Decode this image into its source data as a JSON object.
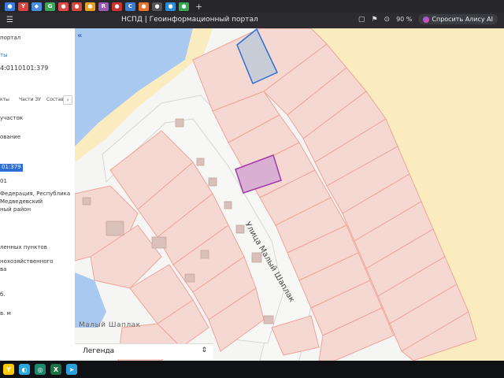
{
  "browser": {
    "page_title": "НСПД | Геоинформационный портал",
    "zoom": "90 %",
    "alice_label": "Спросить Алису AI",
    "tab_favicons": [
      {
        "name": "tab-favicon-1",
        "color": "#3b7ddd",
        "glyph": "●"
      },
      {
        "name": "tab-favicon-2",
        "color": "#d9463e",
        "glyph": "Y"
      },
      {
        "name": "tab-favicon-3",
        "color": "#4a8fe0",
        "glyph": "◆"
      },
      {
        "name": "tab-favicon-4",
        "color": "#3aa757",
        "glyph": "G"
      },
      {
        "name": "tab-favicon-5",
        "color": "#e04848",
        "glyph": "●"
      },
      {
        "name": "tab-favicon-6",
        "color": "#d9463e",
        "glyph": "●"
      },
      {
        "name": "tab-favicon-7",
        "color": "#e8a023",
        "glyph": "●"
      },
      {
        "name": "tab-favicon-8",
        "color": "#9b59b6",
        "glyph": "R"
      },
      {
        "name": "tab-favicon-9",
        "color": "#cc3333",
        "glyph": "●"
      },
      {
        "name": "tab-favicon-10",
        "color": "#3a7bd5",
        "glyph": "C"
      },
      {
        "name": "tab-favicon-11",
        "color": "#e8732b",
        "glyph": "●"
      },
      {
        "name": "tab-favicon-12",
        "color": "#555555",
        "glyph": "●"
      },
      {
        "name": "tab-favicon-13",
        "color": "#2a8dd4",
        "glyph": "●"
      },
      {
        "name": "tab-favicon-14",
        "color": "#3aa757",
        "glyph": "●"
      }
    ]
  },
  "sidebar": {
    "line_portal": "портал",
    "line_link": "ты",
    "cadastral_number": "4:0110101:379",
    "tabs": [
      "кты",
      "Части ЗУ",
      "Состав"
    ],
    "tab_arrow": "›",
    "line_plot": "участок",
    "line_name": "ование",
    "highlight_number": "01:379",
    "line_01": "01",
    "addr_1": "Федерация, Республика",
    "addr_2": "Медведевский",
    "addr_3": "ный район",
    "cat_1": "ленных пунктов",
    "use_1": "нохозяйственного",
    "use_2": "ва",
    "val_b": "б.",
    "val_area": "в. м"
  },
  "map": {
    "street_label": "Улица Малый Шаплак",
    "village_label": "Малый Шаплак",
    "legend_label": "Легенда",
    "colors": {
      "water": "#a9c9f0",
      "field": "#fbecc0",
      "parcel_fill": "#f6d8d2",
      "parcel_stroke": "#f0a398",
      "road": "#f7f7f5",
      "road_edge": "#cfcfcf",
      "selected_fill": "#d9b0d4",
      "selected_stroke": "#a23aa8",
      "blue_parcel_fill": "#c8ccd6",
      "blue_parcel_stroke": "#2d6fd6"
    }
  },
  "taskbar": {
    "icons": [
      {
        "name": "yandex-browser-icon",
        "color": "#ffcc00",
        "glyph": "Y"
      },
      {
        "name": "browser-icon",
        "color": "#2aa9e0",
        "glyph": "◐"
      },
      {
        "name": "app-icon",
        "color": "#1e8a6d",
        "glyph": "◎"
      },
      {
        "name": "excel-icon",
        "color": "#1d7044",
        "glyph": "X"
      },
      {
        "name": "telegram-icon",
        "color": "#2aa1da",
        "glyph": "➤"
      }
    ]
  }
}
